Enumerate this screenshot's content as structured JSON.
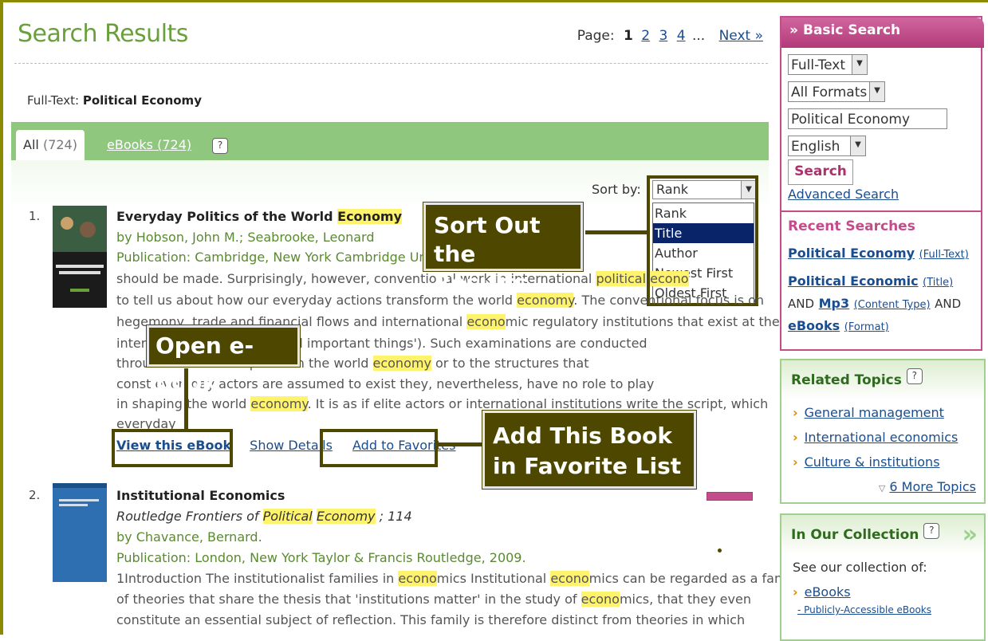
{
  "page": {
    "title": "Search Results"
  },
  "pager": {
    "label": "Page:",
    "current": "1",
    "pages": [
      "2",
      "3",
      "4"
    ],
    "ellipsis": "...",
    "next": "Next »"
  },
  "query": {
    "label": "Full-Text:",
    "value": "Political Economy"
  },
  "tabs": {
    "all": "All",
    "all_count": "(724)",
    "ebooks": "eBooks (724)",
    "help": "?"
  },
  "sort": {
    "label": "Sort by:",
    "selected": "Rank",
    "options": [
      "Rank",
      "Title",
      "Author",
      "Newest First",
      "Oldest First"
    ]
  },
  "results": [
    {
      "num": "1.",
      "title": "Everyday Politics of the World ",
      "title_hl": "Economy",
      "authors": "by Hobson, John M.; Seabrooke, Leonard",
      "publication": "Publication: Cambridge, New York Cambridge Univer",
      "lines": [
        "should be made. Surprisingly, however, conventional work in international political econo",
        "to tell us about how our everyday actions transform the world economy. The conventional focus is on",
        "hegemony, trade and financial flows and international economic regulatory institutions that exist at the",
        "interna                    all number of big and important things'). Such examinations are conducted",
        "throu                    ites who wield power in the world economy or to the structures that",
        "const                    everyday actors are assumed to exist they, nevertheless, have no role to play",
        "in shaping the world economy. It is as if elite actors or international institutions write the script, which",
        "everyday"
      ],
      "actions": {
        "view": "View this eBook",
        "details": "Show Details",
        "favorites": "Add to Favorites"
      }
    },
    {
      "num": "2.",
      "title": "Institutional Economics",
      "series": "Routledge Frontiers of Political Economy ; 114",
      "authors": "by Chavance, Bernard.",
      "publication": "Publication: London, New York Taylor & Francis Routledge, 2009.",
      "lines": [
        "1Introduction The institutionalist families in economics Institutional economics can be regarded as a family",
        "of theories that share the thesis that 'institutions matter' in the study of economics, that they even",
        "constitute an essential subject of reflection. This family is therefore distinct from theories in which"
      ]
    }
  ],
  "callouts": {
    "sort": "Sort Out the Results",
    "open": "Open e-book",
    "add": "Add This Book in Favorite List"
  },
  "sidebar": {
    "basic_search": {
      "title": "Basic Search",
      "field": "Full-Text",
      "format": "All Formats",
      "query": "Political Economy",
      "language": "English",
      "button": "Search",
      "advanced": "Advanced Search"
    },
    "recent": {
      "title": "Recent Searches",
      "item1": "Political Economy",
      "item1_note": "(Full-Text)",
      "item2a": "Political Economic",
      "item2a_note": "(Title)",
      "and1": "AND",
      "item2b": "Mp3",
      "item2b_note": "(Content Type)",
      "and2": "AND",
      "item2c": "eBooks",
      "item2c_note": "(Format)"
    },
    "related": {
      "title": "Related Topics",
      "items": [
        "General management",
        "International economics",
        "Culture & institutions"
      ],
      "more": "6 More Topics"
    },
    "collection": {
      "title": "In Our Collection",
      "text": "See our collection of:",
      "link": "eBooks",
      "sub": "- Publicly-Accessible eBooks"
    }
  },
  "colors": {
    "accent_green": "#6aa03c",
    "tab_green": "#8fc77f",
    "pink": "#c34d8a",
    "callout": "#4d4700",
    "highlight": "#fff36b"
  }
}
